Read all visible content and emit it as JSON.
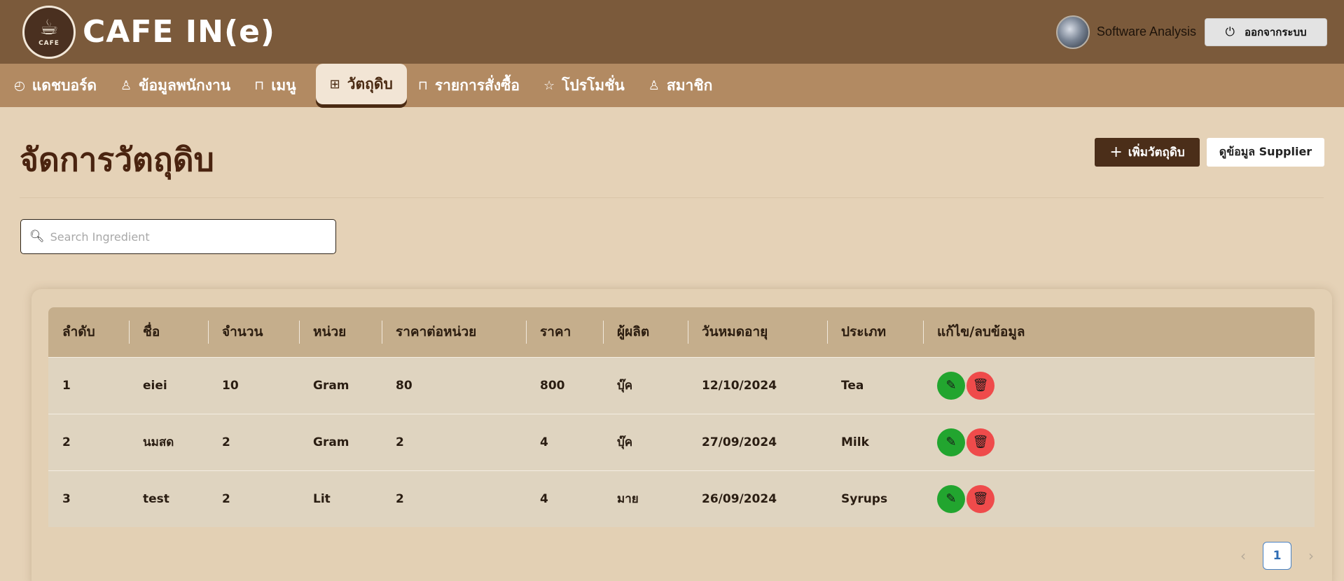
{
  "brand": {
    "name": "CAFE IN(e)",
    "logo_text": "CAFE"
  },
  "header": {
    "user_name": "Software Analysis",
    "logout_label": "ออกจากระบบ",
    "logout_icon": "logout-icon"
  },
  "nav": {
    "items": [
      {
        "label": "แดชบอร์ด",
        "icon": "dashboard-icon",
        "glyph": "◴",
        "active": false
      },
      {
        "label": "ข้อมูลพนักงาน",
        "icon": "user-icon",
        "glyph": "♙",
        "active": false
      },
      {
        "label": "เมนู",
        "icon": "bag-icon",
        "glyph": "⊓",
        "active": false
      },
      {
        "label": "วัตถุดิบ",
        "icon": "grid-icon",
        "glyph": "⊞",
        "active": true
      },
      {
        "label": "รายการสั่งซื้อ",
        "icon": "bag-icon",
        "glyph": "⊓",
        "active": false
      },
      {
        "label": "โปรโมชั่น",
        "icon": "star-icon",
        "glyph": "☆",
        "active": false
      },
      {
        "label": "สมาชิก",
        "icon": "user-icon",
        "glyph": "♙",
        "active": false
      }
    ]
  },
  "page": {
    "title": "จัดการวัตถุดิบ",
    "add_button": "เพิ่มวัตถุดิบ",
    "supplier_button": "ดูข้อมูล Supplier"
  },
  "search": {
    "placeholder": "Search Ingredient",
    "value": ""
  },
  "table": {
    "columns": [
      "ลำดับ",
      "ชื่อ",
      "จำนวน",
      "หน่วย",
      "ราคาต่อหน่วย",
      "ราคา",
      "ผู้ผลิต",
      "วันหมดอายุ",
      "ประเภท",
      "แก้ไข/ลบข้อมูล"
    ],
    "rows": [
      [
        "1",
        "eiei",
        "10",
        "Gram",
        "80",
        "800",
        "บุ๊ค",
        "12/10/2024",
        "Tea"
      ],
      [
        "2",
        "นมสด",
        "2",
        "Gram",
        "2",
        "4",
        "บุ๊ค",
        "27/09/2024",
        "Milk"
      ],
      [
        "3",
        "test",
        "2",
        "Lit",
        "2",
        "4",
        "มาย",
        "26/09/2024",
        "Syrups"
      ]
    ]
  },
  "pagination": {
    "current_page": "1",
    "prev": "‹",
    "next": "›"
  },
  "colors": {
    "header_bg": "#7b5a3b",
    "nav_bg": "#b28a62",
    "page_bg": "#e5d2b7",
    "edit_green": "#22a52f",
    "delete_red": "#ef4b4b"
  }
}
